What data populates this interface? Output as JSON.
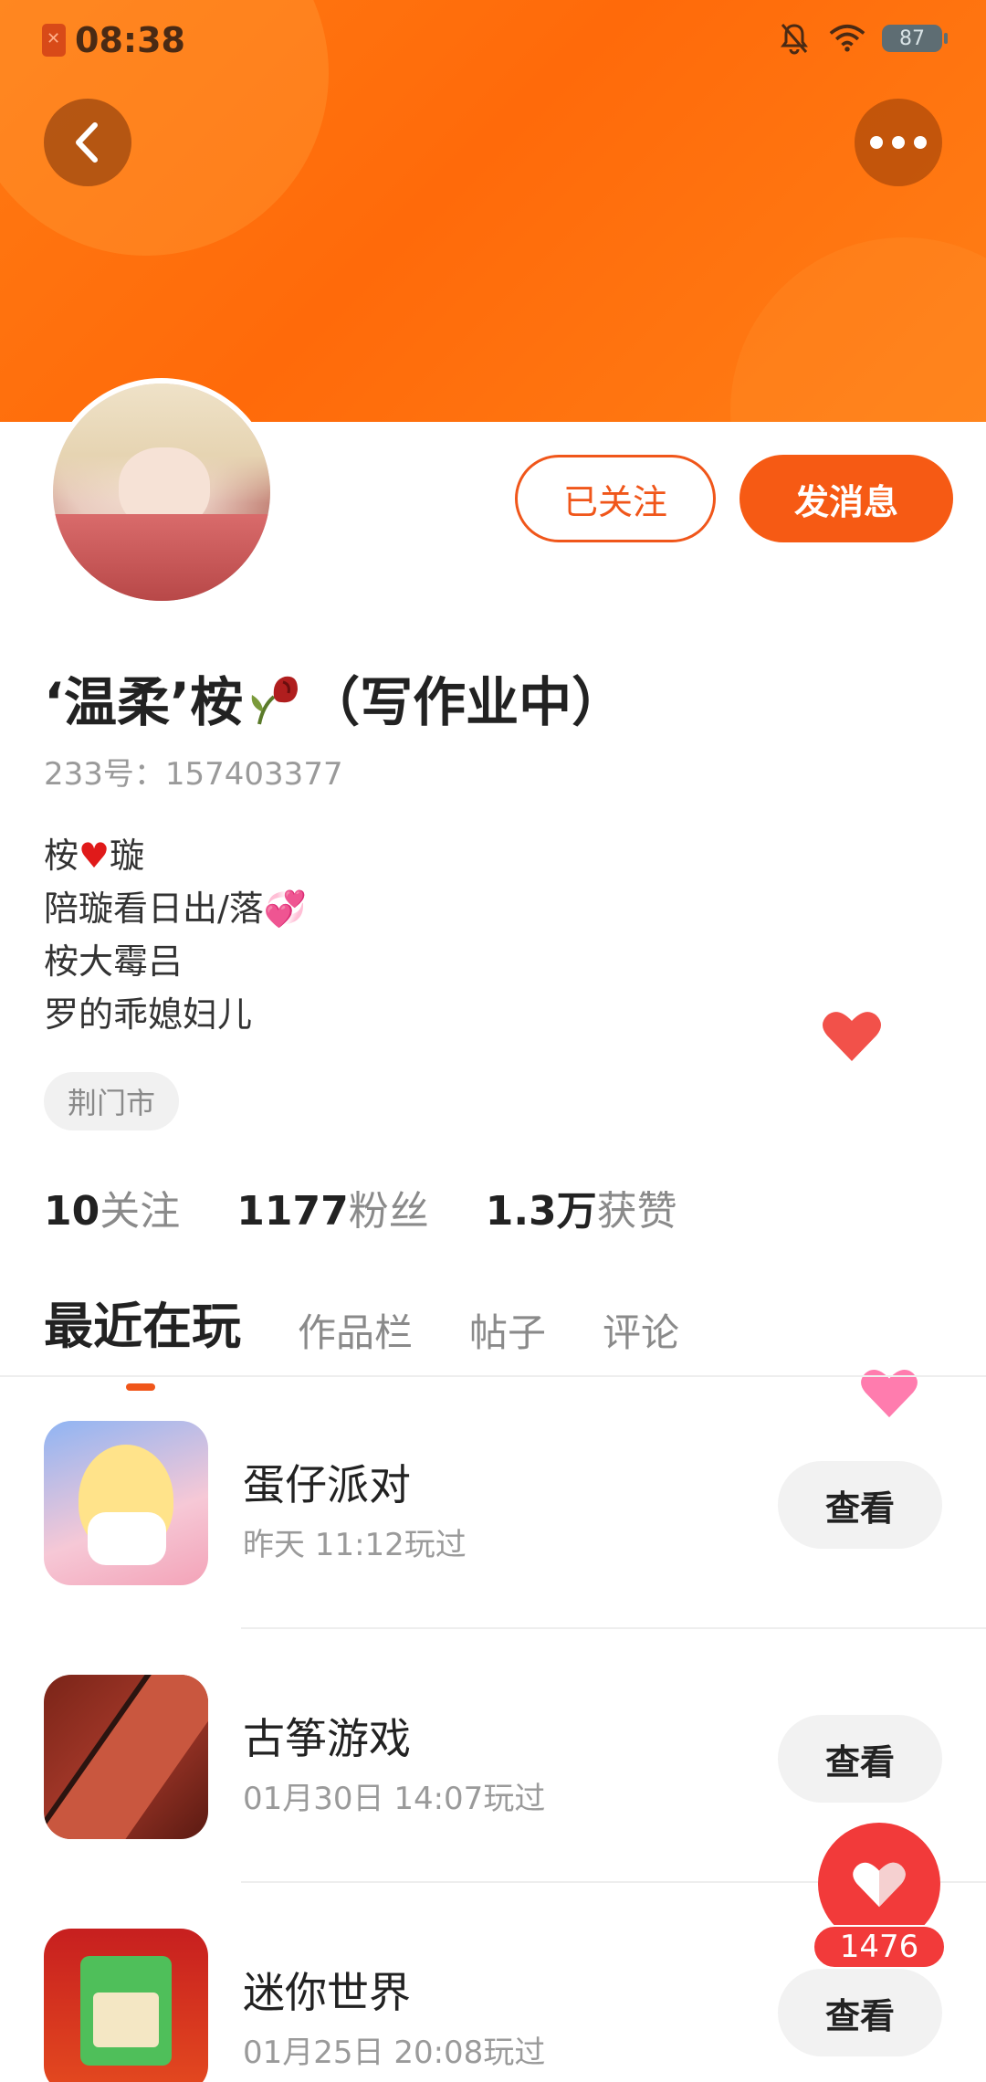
{
  "status_bar": {
    "time": "08:38",
    "battery": "87"
  },
  "header": {
    "back_icon": "chevron-left-icon",
    "more_icon": "more-dots-icon"
  },
  "profile": {
    "follow_button": "已关注",
    "message_button": "发消息",
    "name_prefix": "‘温柔’桉",
    "name_suffix": "（写作业中）",
    "id_line": "233号：157403377",
    "bio": {
      "line1_a": "桉",
      "line1_heart": "♥",
      "line1_b": "璇",
      "line2": "陪璇看日出/落💞",
      "line3": "桉大霉吕",
      "line4": "罗的乖媳妇儿"
    },
    "location_tag": "荆门市",
    "stats": {
      "following_num": "10",
      "following_label": "关注",
      "fans_num": "1177",
      "fans_label": "粉丝",
      "likes_num": "1.3万",
      "likes_label": "获赞"
    }
  },
  "tabs": [
    "最近在玩",
    "作品栏",
    "帖子",
    "评论"
  ],
  "games": [
    {
      "title": "蛋仔派对",
      "time": "昨天 11:12玩过",
      "button": "查看"
    },
    {
      "title": "古筝游戏",
      "time": "01月30日 14:07玩过",
      "button": "查看"
    },
    {
      "title": "迷你世界",
      "time": "01月25日 20:08玩过",
      "button": "查看"
    }
  ],
  "like_fab": {
    "count": "1476"
  },
  "colors": {
    "brand_orange": "#f65a14",
    "like_red": "#f23a3a"
  }
}
